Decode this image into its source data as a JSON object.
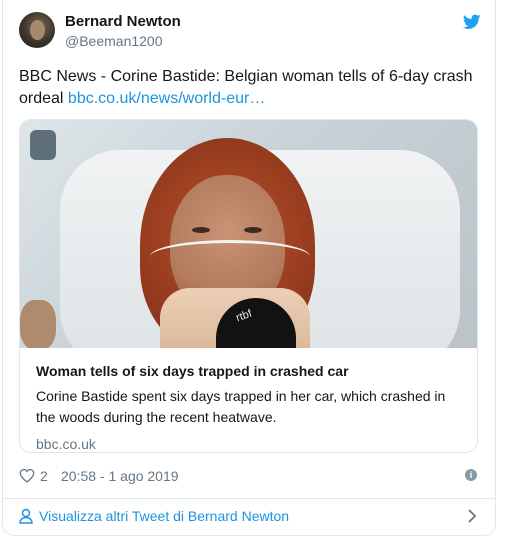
{
  "author": {
    "name": "Bernard Newton",
    "handle": "@Beeman1200"
  },
  "icons": {
    "brand": "twitter-bird-icon",
    "like": "heart-icon",
    "info": "info-icon",
    "profile": "user-icon",
    "more": "chevron-right-icon"
  },
  "colors": {
    "accent": "#1b95e0",
    "text": "#14171a",
    "muted": "#657786",
    "border": "#e1e8ed"
  },
  "tweet": {
    "text": "BBC News - Corine Bastide: Belgian woman tells of 6-day crash ordeal ",
    "link": "bbc.co.uk/news/world-eur…"
  },
  "card": {
    "image_text": "rtbf",
    "title": "Woman tells of six days trapped in crashed car",
    "description": "Corine Bastide spent six days trapped in her car, which crashed in the woods during the recent heatwave.",
    "domain": "bbc.co.uk"
  },
  "meta": {
    "likes": "2",
    "timestamp": "20:58 - 1 ago 2019"
  },
  "footer": {
    "label": "Visualizza altri Tweet di Bernard Newton"
  }
}
